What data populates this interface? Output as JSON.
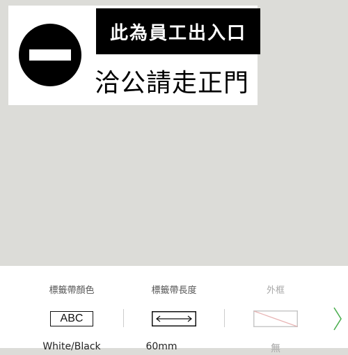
{
  "label": {
    "banner_text": "此為員工出入口",
    "sub_text": "洽公請走正門"
  },
  "toolbar": {
    "items": [
      {
        "title": "標籤帶顏色",
        "value": "White/Black",
        "icon": "abc-swatch-icon",
        "icon_text": "ABC"
      },
      {
        "title": "標籤帶長度",
        "value": "60mm",
        "icon": "double-arrow-icon"
      },
      {
        "title": "外框",
        "value": "無",
        "icon": "no-frame-icon"
      }
    ],
    "next_icon": "chevron-right-icon"
  },
  "colors": {
    "canvas_bg": "#dcdcd8",
    "toolbar_bg": "#ffffff",
    "accent_green": "#4caf50",
    "sign_red_black": "#000000"
  }
}
